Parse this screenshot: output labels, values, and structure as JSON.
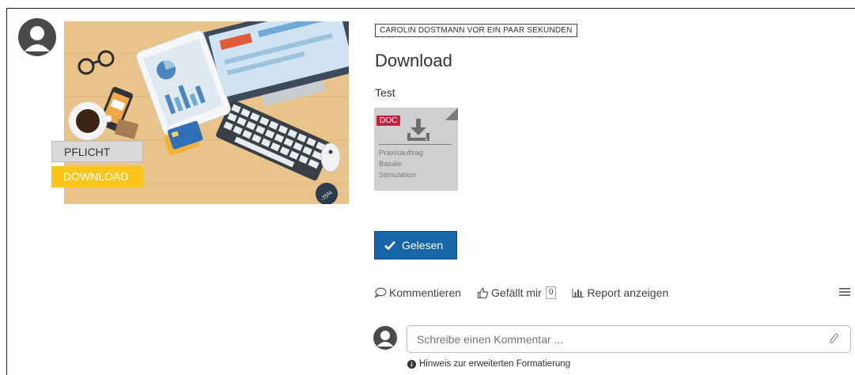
{
  "post": {
    "meta": "CAROLIN DOSTMANN VOR EIN PAAR SEKUNDEN",
    "title": "Download",
    "description": "Test"
  },
  "tags": {
    "pflicht": "PFLICHT",
    "download": "DOWNLOAD"
  },
  "hero": {
    "sale_badge": "-75%"
  },
  "attachment": {
    "type_badge": "DOC",
    "name": "Praxisauftrag\nBasale\nStimulation"
  },
  "read_button": {
    "label": "Gelesen"
  },
  "actions": {
    "comment_label": "Kommentieren",
    "like_label": "Gefällt mir",
    "like_count": "0",
    "report_label": "Report anzeigen"
  },
  "comment_box": {
    "placeholder": "Schreibe einen Kommentar ..."
  },
  "hint": {
    "label": "Hinweis zur erweiterten Formatierung"
  },
  "colors": {
    "primary": "#1565a7",
    "tag_yellow": "#fbc519",
    "doc_red": "#c8213f"
  },
  "icons": [
    "user-avatar-icon",
    "speech-bubble-icon",
    "thumbs-up-icon",
    "bar-chart-icon",
    "hamburger-menu-icon",
    "paperclip-icon",
    "info-icon",
    "download-icon",
    "check-icon"
  ]
}
